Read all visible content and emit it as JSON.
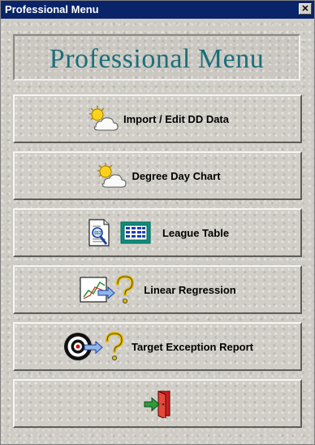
{
  "window": {
    "title": "Professional Menu",
    "close_glyph": "✕"
  },
  "header": {
    "title": "Professional Menu"
  },
  "menu": {
    "items": [
      {
        "label": "Import / Edit DD Data",
        "icon": "sun-cloud-icon"
      },
      {
        "label": "Degree Day Chart",
        "icon": "sun-cloud-icon"
      },
      {
        "label": "League Table",
        "icon": "report-and-table-icon"
      },
      {
        "label": "Linear Regression",
        "icon": "chart-question-icon"
      },
      {
        "label": "Target Exception Report",
        "icon": "target-question-icon"
      },
      {
        "label": "",
        "icon": "exit-door-icon"
      }
    ]
  },
  "colors": {
    "title_bar": "#0a246a",
    "header_text": "#1c6f7a"
  }
}
